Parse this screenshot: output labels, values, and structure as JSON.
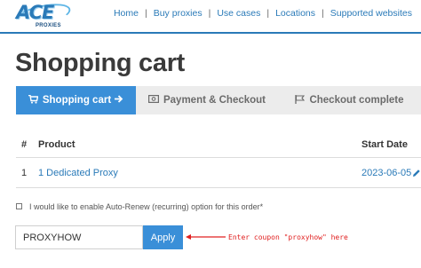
{
  "header": {
    "logo_text": "ACE",
    "logo_sub": "PROXIES",
    "nav": [
      "Home",
      "Buy proxies",
      "Use cases",
      "Locations",
      "Supported websites"
    ],
    "separator": "|",
    "accent_color": "#2a7ab8"
  },
  "page": {
    "title": "Shopping cart"
  },
  "steps": [
    {
      "label": "Shopping cart",
      "icon": "cart-icon",
      "active": true,
      "trailing_icon": "arrow-right-icon"
    },
    {
      "label": "Payment & Checkout",
      "icon": "money-icon",
      "active": false
    },
    {
      "label": "Checkout complete",
      "icon": "flag-icon",
      "active": false
    }
  ],
  "table": {
    "headers": [
      "#",
      "Product",
      "Start Date"
    ],
    "rows": [
      {
        "num": "1",
        "product": "1 Dedicated Proxy",
        "start_date": "2023-06-05",
        "edit_icon": "pencil-icon"
      }
    ]
  },
  "auto_renew": {
    "label": "I would like to enable Auto-Renew (recurring) option for this order*",
    "checked": false
  },
  "coupon": {
    "value": "PROXYHOW",
    "apply_label": "Apply",
    "annotation": "Enter coupon \"proxyhow\" here",
    "annotation_color": "#e02020"
  }
}
